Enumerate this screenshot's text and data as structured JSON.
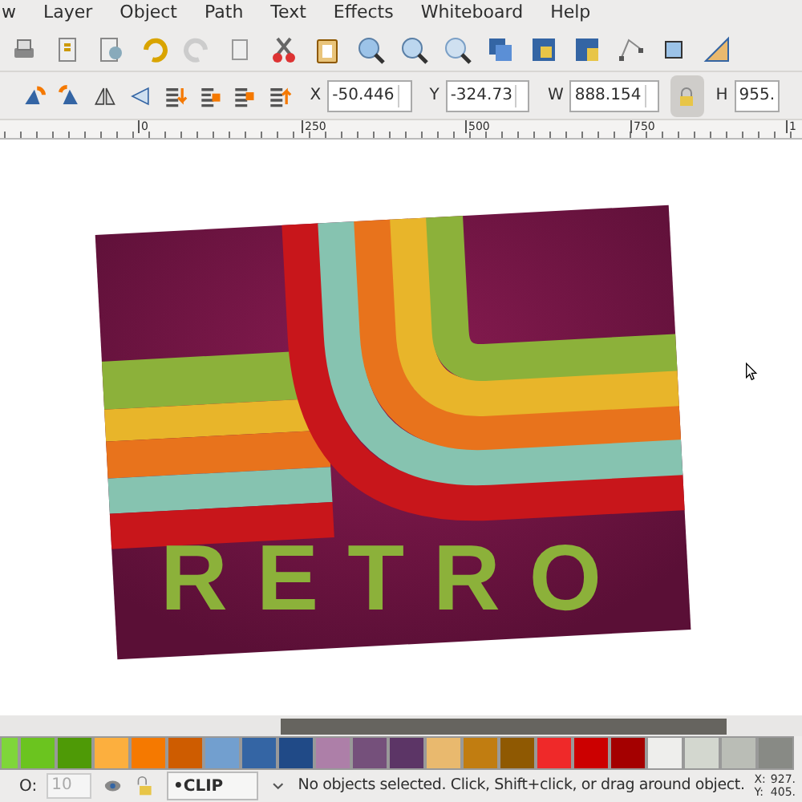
{
  "menu": [
    "w",
    "Layer",
    "Object",
    "Path",
    "Text",
    "Effects",
    "Whiteboard",
    "Help"
  ],
  "selector_toolbar": {
    "fields": [
      {
        "label": "X",
        "value": "-50.446"
      },
      {
        "label": "Y",
        "value": "-324.73"
      },
      {
        "label": "W",
        "value": "888.154"
      }
    ],
    "lock": {
      "on": true
    },
    "h_field": {
      "label": "H",
      "value": "955."
    }
  },
  "ruler": {
    "labels": [
      "0",
      "250",
      "500",
      "750",
      "1"
    ]
  },
  "canvas": {
    "artwork_text": "RETRO"
  },
  "palette": {
    "swatches": [
      {
        "color": "#7fd63a"
      },
      {
        "color": "#6bc41f"
      },
      {
        "color": "#4e9a06"
      },
      {
        "color": "#fcaf3e"
      },
      {
        "color": "#f57900"
      },
      {
        "color": "#ce5c00"
      },
      {
        "color": "#729fcf"
      },
      {
        "color": "#3465a4"
      },
      {
        "color": "#204a87"
      },
      {
        "color": "#ad7fa8"
      },
      {
        "color": "#75507b"
      },
      {
        "color": "#5c3566"
      },
      {
        "color": "#e9b96e"
      },
      {
        "color": "#c17d11"
      },
      {
        "color": "#8f5902"
      },
      {
        "color": "#ef2929"
      },
      {
        "color": "#cc0000"
      },
      {
        "color": "#a40000"
      },
      {
        "color": "#eeeeec"
      },
      {
        "color": "#d3d7cf"
      },
      {
        "color": "#babdb6"
      },
      {
        "color": "#888a85"
      }
    ]
  },
  "status_bar": {
    "opacity_label": "O:",
    "opacity_value": "10",
    "layer": "•CLIP",
    "message": "No objects selected. Click, Shift+click, or drag around object.",
    "x_label": "X:",
    "x_value": "927.",
    "y_label": "Y:",
    "y_value": "405."
  }
}
